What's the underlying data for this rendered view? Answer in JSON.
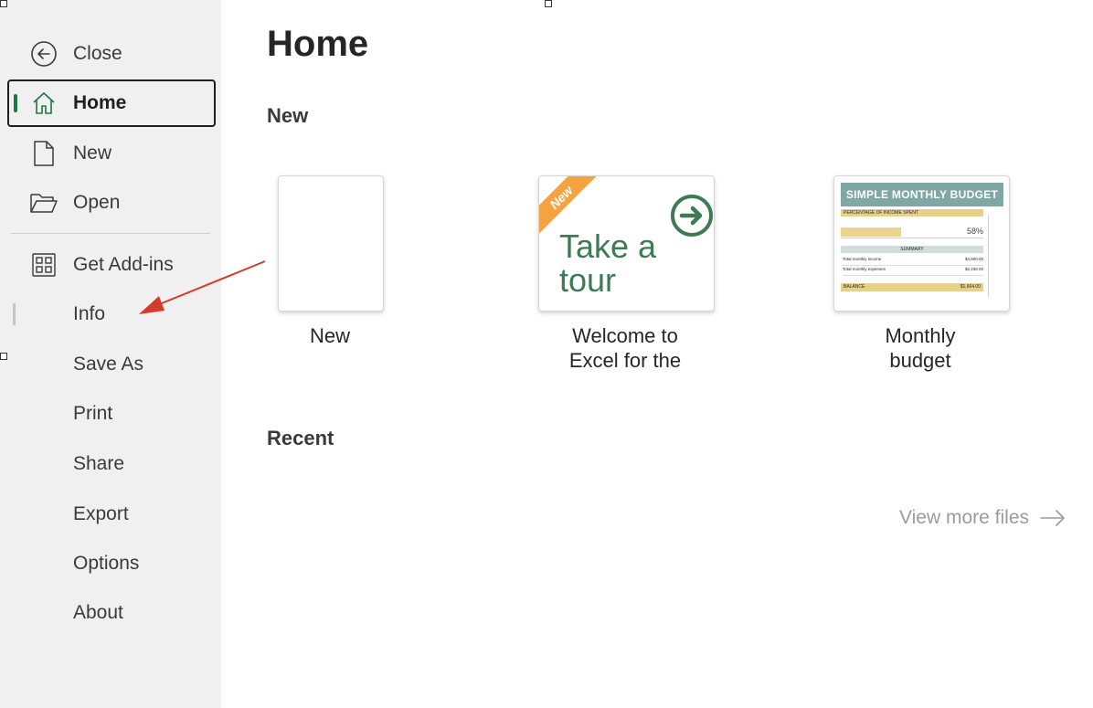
{
  "sidebar": {
    "close": "Close",
    "home": "Home",
    "new": "New",
    "open": "Open",
    "addins": "Get Add-ins",
    "info": "Info",
    "save_as": "Save As",
    "print": "Print",
    "share": "Share",
    "export": "Export",
    "options": "Options",
    "about": "About"
  },
  "main": {
    "title": "Home",
    "new_section": "New",
    "recent_section": "Recent",
    "view_more": "View more files",
    "templates": [
      {
        "caption_line1": "New",
        "caption_line2": ""
      },
      {
        "caption_line1": "Welcome to",
        "caption_line2": "Excel for the",
        "badge": "New",
        "thumb_line1": "Take a",
        "thumb_line2": "tour"
      },
      {
        "caption_line1": "Monthly",
        "caption_line2": "budget",
        "thumb_title": "SIMPLE MONTHLY BUDGET",
        "thumb_row1": "PERCENTAGE OF INCOME SPENT",
        "thumb_pct": "58%",
        "thumb_summary": "SUMMARY",
        "thumb_income": "Total monthly income",
        "thumb_income_val": "$4,900.00",
        "thumb_expenses": "Total monthly expenses",
        "thumb_expenses_val": "$2,236.00",
        "thumb_balance": "BALANCE",
        "thumb_balance_val": "$1,664.00"
      }
    ]
  },
  "colors": {
    "accent": "#217346",
    "sidebar_bg": "#f0f0f0",
    "badge": "#f4a340",
    "tour_text": "#3d7a55",
    "annotation_arrow": "#d63a2a"
  }
}
